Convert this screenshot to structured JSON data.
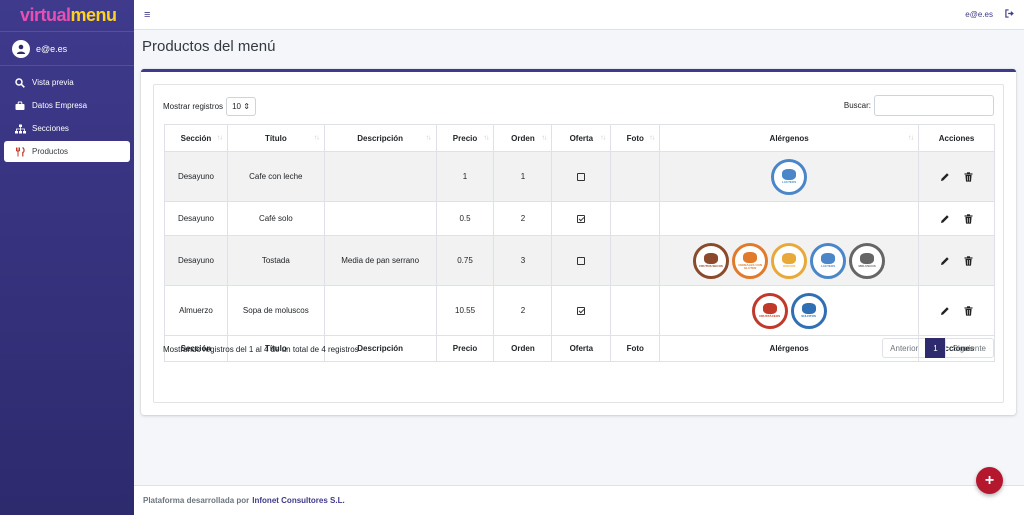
{
  "brand": {
    "part1": "virtual",
    "part2": "menu"
  },
  "user": {
    "name": "e@e.es"
  },
  "sidebar": {
    "items": [
      {
        "label": "Vista previa",
        "icon": "search-icon"
      },
      {
        "label": "Datos Empresa",
        "icon": "briefcase-icon"
      },
      {
        "label": "Secciones",
        "icon": "sitemap-icon"
      },
      {
        "label": "Productos",
        "icon": "utensils-icon",
        "active": true
      }
    ]
  },
  "topbar": {
    "menu_icon": "≡",
    "user": "e@e.es",
    "logout_icon": "sign-out-icon"
  },
  "page": {
    "title": "Productos del menú"
  },
  "table_controls": {
    "length_label": "Mostrar registros",
    "length_value": "10 ⇕",
    "search_label": "Buscar:",
    "search_value": ""
  },
  "table": {
    "headers": [
      "Sección",
      "Título",
      "Descripción",
      "Precio",
      "Orden",
      "Oferta",
      "Foto",
      "Alérgenos",
      "Acciones"
    ],
    "rows": [
      {
        "seccion": "Desayuno",
        "titulo": "Cafe con leche",
        "descripcion": "",
        "precio": "1",
        "orden": "1",
        "oferta": false,
        "alergenos": [
          {
            "name": "LACTEOS",
            "color": "#4a86c8"
          }
        ]
      },
      {
        "seccion": "Desayuno",
        "titulo": "Café solo",
        "descripcion": "",
        "precio": "0.5",
        "orden": "2",
        "oferta": true,
        "alergenos": []
      },
      {
        "seccion": "Desayuno",
        "titulo": "Tostada",
        "descripcion": "Media de pan serrano",
        "precio": "0.75",
        "orden": "3",
        "oferta": false,
        "alergenos": [
          {
            "name": "FRUTOS SECOS",
            "color": "#8b4a2b"
          },
          {
            "name": "CEREALES CON GLUTEN",
            "color": "#e07a2c"
          },
          {
            "name": "HUEVOS",
            "color": "#e8a93a"
          },
          {
            "name": "LACTEOS",
            "color": "#4a86c8"
          },
          {
            "name": "MOLUSCOS",
            "color": "#666666"
          }
        ]
      },
      {
        "seccion": "Almuerzo",
        "titulo": "Sopa de moluscos",
        "descripcion": "",
        "precio": "10.55",
        "orden": "2",
        "oferta": true,
        "alergenos": [
          {
            "name": "CRUSTÁCEOS",
            "color": "#c0392b"
          },
          {
            "name": "SULFITOS",
            "color": "#2f6fb3"
          }
        ]
      }
    ]
  },
  "info": {
    "text": "Mostrando registros del 1 al 4 de un total de 4 registros"
  },
  "pagination": {
    "prev": "Anterior",
    "current": "1",
    "next": "Siguiente"
  },
  "footer": {
    "text": "Plataforma desarrollada por",
    "company": "Infonet Consultores S.L."
  },
  "fab": {
    "label": "+"
  },
  "colors": {
    "sidebar": "#3f3a8c",
    "accent": "#b5172f",
    "active_page": "#2d2a6e"
  }
}
